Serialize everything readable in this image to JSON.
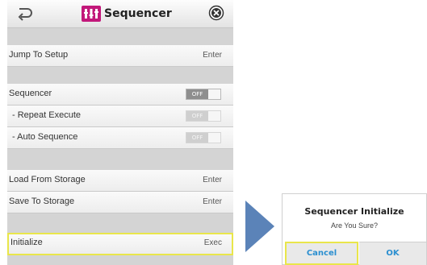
{
  "header": {
    "title": "Sequencer",
    "back_icon": "back-arrow-icon",
    "app_icon": "sequencer-icon",
    "close_icon": "close-icon"
  },
  "menu": {
    "jump_to_setup": {
      "label": "Jump To Setup",
      "value": "Enter"
    },
    "sequencer": {
      "label": "Sequencer",
      "state": "OFF"
    },
    "repeat_execute": {
      "label": "- Repeat Execute",
      "state": "OFF"
    },
    "auto_sequence": {
      "label": "- Auto Sequence",
      "state": "OFF"
    },
    "load_from_storage": {
      "label": "Load From Storage",
      "value": "Enter"
    },
    "save_to_storage": {
      "label": "Save To Storage",
      "value": "Enter"
    },
    "initialize": {
      "label": "Initialize",
      "value": "Exec"
    }
  },
  "dialog": {
    "title": "Sequencer Initialize",
    "message": "Are You Sure?",
    "cancel_label": "Cancel",
    "ok_label": "OK"
  },
  "colors": {
    "highlight": "#e9e64a",
    "arrow": "#5b83b8",
    "button_text": "#2b8fd0",
    "app_icon": "#c2187a"
  }
}
